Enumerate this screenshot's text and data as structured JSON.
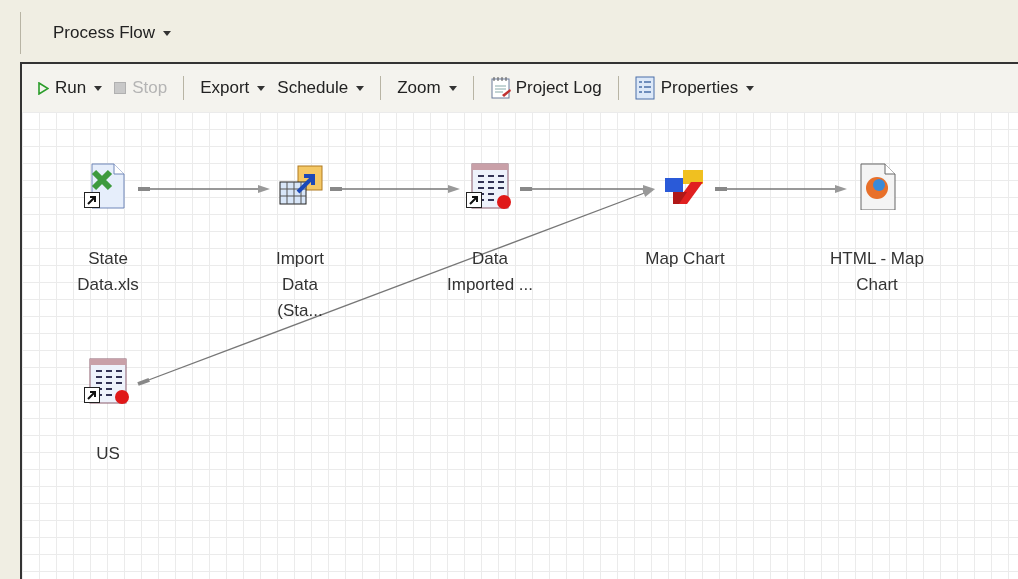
{
  "panel": {
    "title": "Process Flow",
    "has_menu": true
  },
  "toolbar": [
    {
      "kind": "run",
      "label": "Run",
      "has_menu": true,
      "disabled": false
    },
    {
      "kind": "stop",
      "label": "Stop",
      "has_menu": false,
      "disabled": true
    },
    {
      "kind": "separator"
    },
    {
      "kind": "text",
      "label": "Export",
      "has_menu": true,
      "disabled": false
    },
    {
      "kind": "text",
      "label": "Schedule",
      "has_menu": true,
      "disabled": false
    },
    {
      "kind": "separator"
    },
    {
      "kind": "text",
      "label": "Zoom",
      "has_menu": true,
      "disabled": false
    },
    {
      "kind": "separator"
    },
    {
      "kind": "log",
      "label": "Project Log",
      "has_menu": false,
      "disabled": false
    },
    {
      "kind": "separator"
    },
    {
      "kind": "properties",
      "label": "Properties",
      "has_menu": true,
      "disabled": false
    }
  ],
  "nodes": [
    {
      "kind": "excel",
      "label": "State Data.xls",
      "shortcut": true
    },
    {
      "kind": "import",
      "label": "Import Data (Sta...",
      "shortcut": false
    },
    {
      "kind": "dataset",
      "label": "Data Imported ...",
      "shortcut": true
    },
    {
      "kind": "chart",
      "label": "Map Chart",
      "shortcut": false
    },
    {
      "kind": "html",
      "label": "HTML - Map Chart",
      "shortcut": false
    },
    {
      "kind": "dataset",
      "label": "US",
      "shortcut": true
    }
  ]
}
